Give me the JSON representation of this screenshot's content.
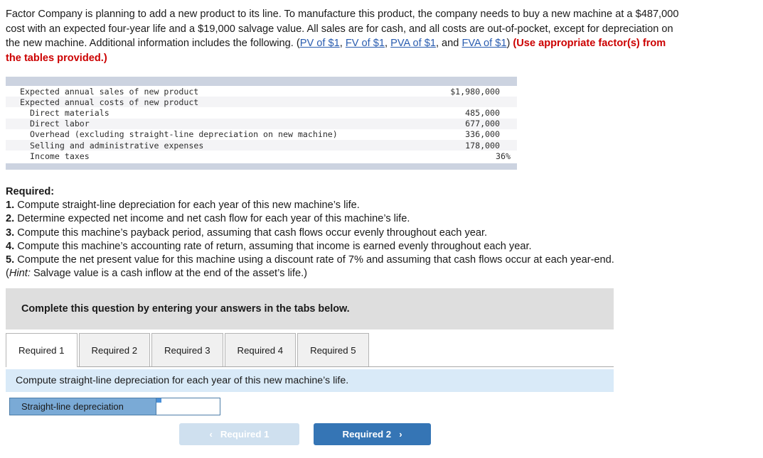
{
  "problem": {
    "part1": "Factor Company is planning to add a new product to its line. To manufacture this product, the company needs to buy a new machine at a $487,000 cost with an expected four-year life and a $19,000 salvage value. All sales are for cash, and all costs are out-of-pocket, except for depreciation on the new machine. Additional information includes the following. (",
    "link1": "PV of $1",
    "sep1": ", ",
    "link2": "FV of $1",
    "sep2": ", ",
    "link3": "PVA of $1",
    "sep3": ", and ",
    "link4": "FVA of $1",
    "part2": ") ",
    "note": "(Use appropriate factor(s) from the tables provided.)"
  },
  "data_table": {
    "rows": [
      {
        "label": "Expected annual sales of new product",
        "value": "$1,980,000",
        "indent": 0,
        "shaded": false
      },
      {
        "label": "Expected annual costs of new product",
        "value": "",
        "indent": 0,
        "shaded": true
      },
      {
        "label": "Direct materials",
        "value": "485,000",
        "indent": 1,
        "shaded": false
      },
      {
        "label": "Direct labor",
        "value": "677,000",
        "indent": 1,
        "shaded": true
      },
      {
        "label": "Overhead (excluding straight-line depreciation on new machine)",
        "value": "336,000",
        "indent": 1,
        "shaded": false
      },
      {
        "label": "Selling and administrative expenses",
        "value": "178,000",
        "indent": 1,
        "shaded": true
      },
      {
        "label": "Income taxes",
        "value": "36%",
        "indent": 1,
        "shaded": false
      }
    ]
  },
  "required": {
    "heading": "Required:",
    "items": [
      {
        "num": "1.",
        "text": " Compute straight-line depreciation for each year of this new machine’s life."
      },
      {
        "num": "2.",
        "text": " Determine expected net income and net cash flow for each year of this machine’s life."
      },
      {
        "num": "3.",
        "text": " Compute this machine’s payback period, assuming that cash flows occur evenly throughout each year."
      },
      {
        "num": "4.",
        "text": " Compute this machine’s accounting rate of return, assuming that income is earned evenly throughout each year."
      },
      {
        "num": "5.",
        "text": " Compute the net present value for this machine using a discount rate of 7% and assuming that cash flows occur at each year-end."
      }
    ],
    "hint_prefix": "(",
    "hint_word": "Hint:",
    "hint_text": " Salvage value is a cash inflow at the end of the asset’s life.)"
  },
  "complete_banner": {
    "text": "Complete this question by entering your answers in the tabs below."
  },
  "tabs": [
    {
      "label": "Required 1",
      "active": true
    },
    {
      "label": "Required 2",
      "active": false
    },
    {
      "label": "Required 3",
      "active": false
    },
    {
      "label": "Required 4",
      "active": false
    },
    {
      "label": "Required 5",
      "active": false
    }
  ],
  "sub_instruction": {
    "text": "Compute straight-line depreciation for each year of this new machine’s life."
  },
  "answer_row": {
    "label": "Straight-line depreciation",
    "value": "",
    "placeholder": ""
  },
  "nav": {
    "prev_label": "Required 1",
    "prev_chevron": "‹",
    "next_label": "Required 2",
    "next_chevron": "›"
  },
  "colors": {
    "link": "#2a5db0",
    "note_red": "#cc0000",
    "table_cap": "#ccd3e0",
    "banner_gray": "#dedede",
    "instruction_blue": "#d9eaf8",
    "label_blue": "#7aaad6",
    "button_blue": "#3575b5",
    "button_disabled": "#cfe0ef"
  }
}
